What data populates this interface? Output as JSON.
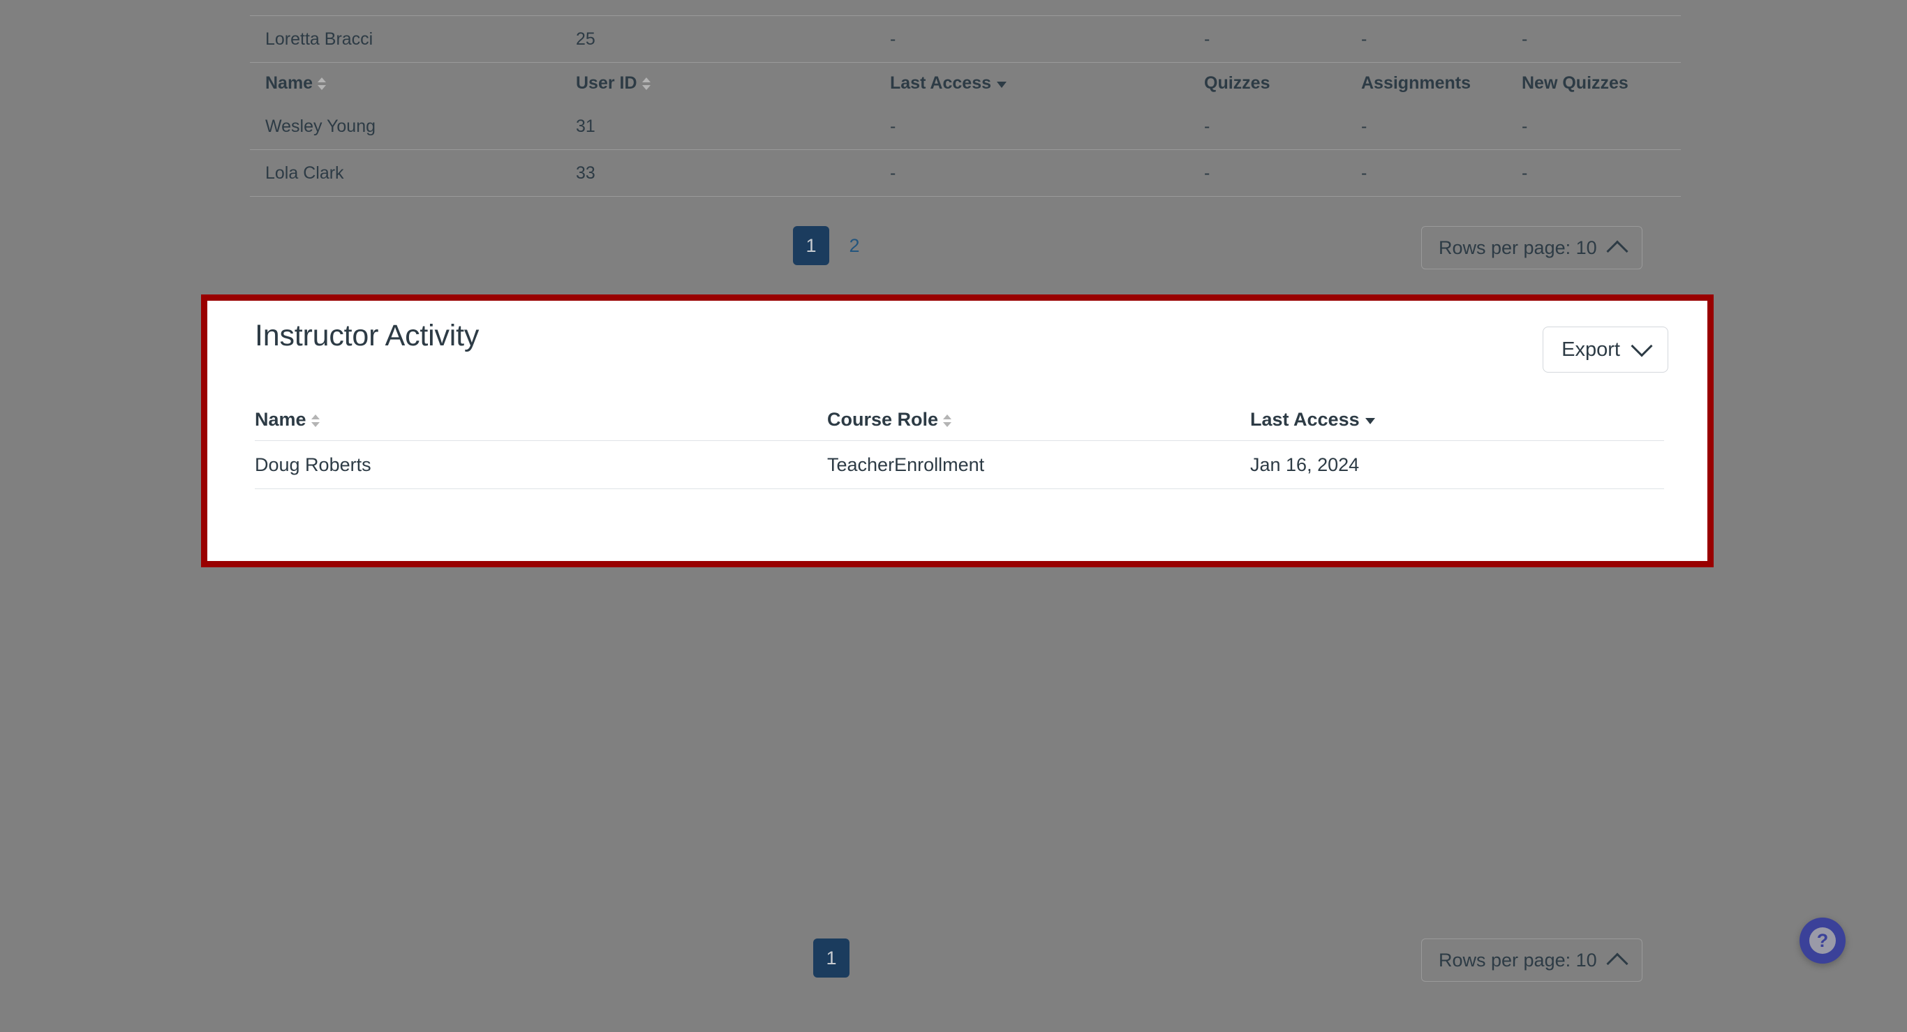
{
  "page": {
    "background_color": "#808080",
    "highlight_border_color": "#990000",
    "accent_color": "#1B3C5E",
    "link_color": "#23557e",
    "text_color": "#2D3B45"
  },
  "student_table": {
    "columns": [
      {
        "label": "Name",
        "sort": "both"
      },
      {
        "label": "User ID",
        "sort": "both"
      },
      {
        "label": "Last Access",
        "sort": "desc"
      },
      {
        "label": "Quizzes",
        "sort": "none"
      },
      {
        "label": "Assignments",
        "sort": "none"
      },
      {
        "label": "New Quizzes",
        "sort": "none"
      }
    ],
    "rows_above_header": [
      {
        "name": "Loretta Bracci",
        "user_id": "25",
        "last_access": "-",
        "quizzes": "-",
        "assignments": "-",
        "new_quizzes": "-"
      }
    ],
    "rows_below_header": [
      {
        "name": "Wesley Young",
        "user_id": "31",
        "last_access": "-",
        "quizzes": "-",
        "assignments": "-",
        "new_quizzes": "-"
      },
      {
        "name": "Lola Clark",
        "user_id": "33",
        "last_access": "-",
        "quizzes": "-",
        "assignments": "-",
        "new_quizzes": "-"
      }
    ]
  },
  "student_pager": {
    "pages": [
      {
        "label": "1",
        "active": true
      },
      {
        "label": "2",
        "active": false
      }
    ],
    "rows_per_page_label": "Rows per page: 10"
  },
  "instructor_panel": {
    "title": "Instructor Activity",
    "export_label": "Export",
    "columns": [
      {
        "label": "Name",
        "sort": "both"
      },
      {
        "label": "Course Role",
        "sort": "both"
      },
      {
        "label": "Last Access",
        "sort": "desc"
      }
    ],
    "rows": [
      {
        "name": "Doug Roberts",
        "course_role": "TeacherEnrollment",
        "last_access": "Jan 16, 2024"
      }
    ]
  },
  "instructor_pager": {
    "pages": [
      {
        "label": "1",
        "active": true
      }
    ],
    "rows_per_page_label": "Rows per page: 10"
  },
  "help_button": {
    "glyph": "?"
  }
}
